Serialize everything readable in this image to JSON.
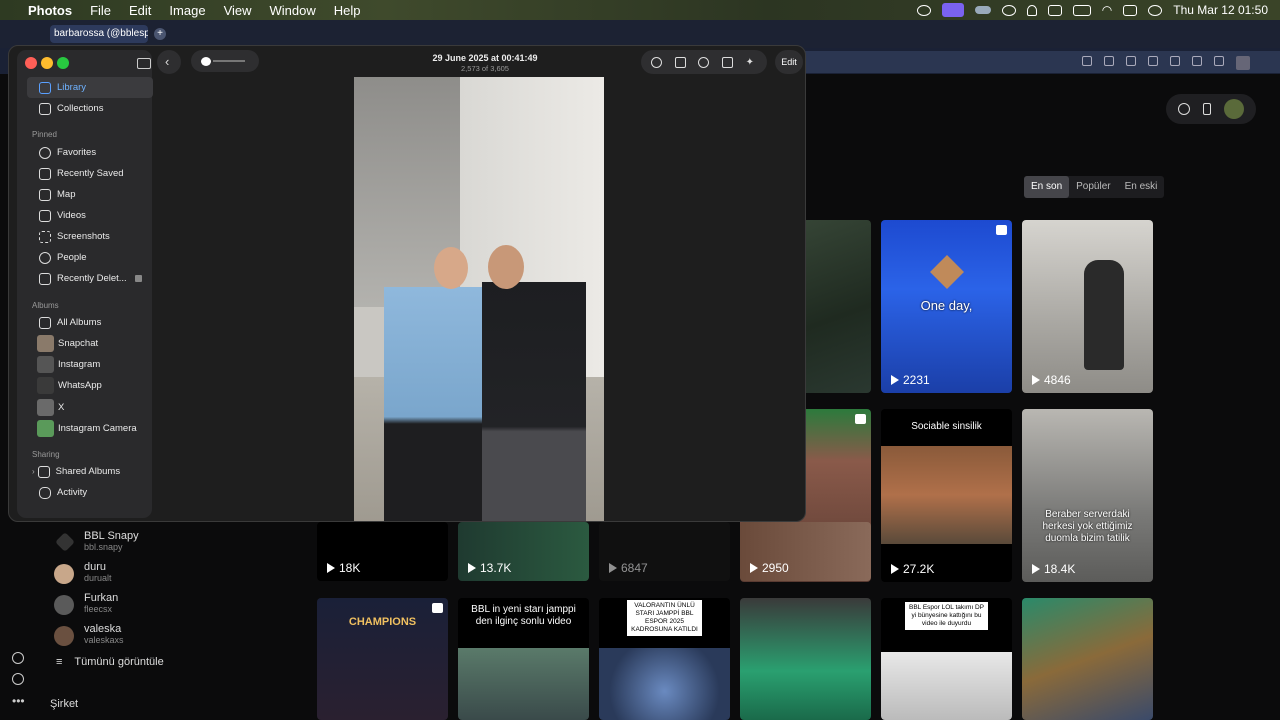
{
  "menubar": {
    "app": "Photos",
    "menus": [
      "File",
      "Edit",
      "Image",
      "View",
      "Window",
      "Help"
    ],
    "clock": "Thu Mar 12  01:50"
  },
  "browser": {
    "tab_title": "barbarossa (@bblesport",
    "tab_plus": "+",
    "filters": [
      "En son",
      "Popüler",
      "En eski"
    ],
    "tiles": [
      {
        "count": "2231",
        "overlay": "One day,"
      },
      {
        "count": "4846"
      },
      {
        "caption": "Sociable sinsilik"
      },
      {
        "overlay": "Beraber serverdaki herkesi yok ettiğimiz duomla bizim tatilik",
        "count": "18.4K"
      },
      {
        "count": "18K"
      },
      {
        "count": "13.7K"
      },
      {
        "count": "6847"
      },
      {
        "count": "2950"
      },
      {
        "count": "27.2K"
      },
      {
        "caption": "CHAMPIONS"
      },
      {
        "caption": "BBL in yeni starı jamppi den ilginç sonlu video"
      },
      {
        "caption": "VALORANTIN ÜNLÜ STARI JAMPPİ BBL ESPOR 2025 KADROSUNA KATILDI"
      },
      {
        "caption": "BBL Espor LOL takımı DP yi bünyesine kattığını bu video ile duyurdu"
      }
    ],
    "accounts": [
      {
        "name": "BBL Snapy",
        "user": "bbl.snapy"
      },
      {
        "name": "duru",
        "user": "durualt"
      },
      {
        "name": "Furkan",
        "user": "fleecsx"
      },
      {
        "name": "valeska",
        "user": "valeskaxs"
      }
    ],
    "view_all": "Tümünü görüntüle",
    "company": "Şirket"
  },
  "photos": {
    "sidebar": {
      "top": [
        "Library",
        "Collections"
      ],
      "pinned_header": "Pinned",
      "pinned": [
        "Favorites",
        "Recently Saved",
        "Map",
        "Videos",
        "Screenshots",
        "People",
        "Recently Delet..."
      ],
      "albums_header": "Albums",
      "albums": [
        "All Albums",
        "Snapchat",
        "Instagram",
        "WhatsApp",
        "X",
        "Instagram Camera"
      ],
      "sharing_header": "Sharing",
      "sharing": [
        "Shared Albums",
        "Activity"
      ]
    },
    "toolbar": {
      "title": "29 June 2025 at 00:41:49",
      "subtitle": "2,573 of 3,605",
      "edit_label": "Edit"
    }
  }
}
